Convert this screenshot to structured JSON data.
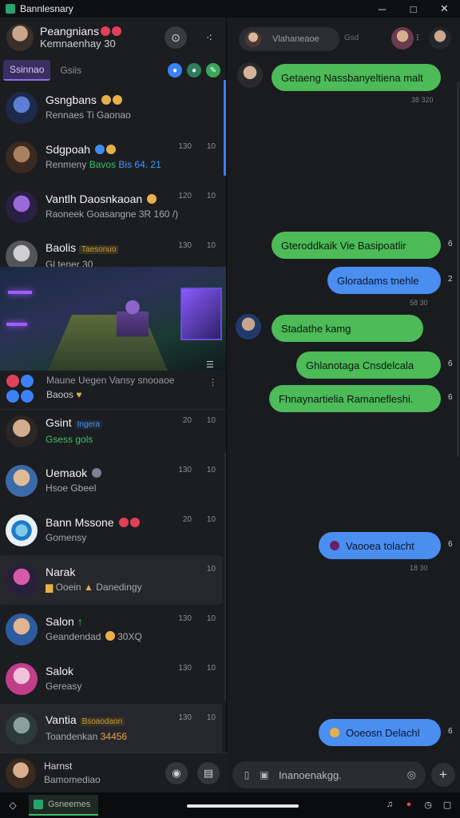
{
  "window": {
    "title": "Bannlesnary",
    "minimize": "─",
    "maximize": "□",
    "close": "✕"
  },
  "profile": {
    "name": "Peangnians",
    "status": "Kemnaenhay 30",
    "btn_search": "⊙",
    "btn_more": "⁖"
  },
  "tabs": [
    {
      "label": "Ssinnao",
      "active": true
    },
    {
      "label": "Gsiis",
      "active": false
    }
  ],
  "chats": [
    {
      "name": "Gsngbans",
      "preview": "Rennaes Ti Gaonao",
      "time": "",
      "badge": ""
    },
    {
      "name": "Sdgpoah",
      "preview": "Renmeny",
      "highlight": "Bavos",
      "highlight2": "Bis 64. 21",
      "time": "130",
      "badge": "10"
    },
    {
      "name": "Vantlh Daosnkaoan",
      "preview": "Raoneek Goasangne 3R 160 /)",
      "time": "120",
      "badge": "10"
    },
    {
      "name": "Baolis",
      "tag": "Taesonuo",
      "preview": "Gl tener 30",
      "time": "130",
      "badge": "10"
    },
    {
      "name": "Gsint",
      "tag": "Ingera",
      "preview": "Gsess gols",
      "time": "20",
      "badge": "10"
    },
    {
      "name": "Uemaok",
      "preview": "Hsoe Gbeel",
      "time": "130",
      "badge": "10"
    },
    {
      "name": "Bann Mssone",
      "preview": "Gomensy",
      "time": "20",
      "badge": "10"
    },
    {
      "name": "Narak",
      "preview": "Ooein",
      "highlight": "Danedingy",
      "time": "",
      "badge": "10"
    },
    {
      "name": "Salon",
      "preview": "Geandendad",
      "highlight": "30XQ",
      "time": "130",
      "badge": "10"
    },
    {
      "name": "Salok",
      "preview": "Gereasy",
      "time": "130",
      "badge": "10"
    },
    {
      "name": "Vantia",
      "tag": "Bsoaodaon",
      "preview": "Toandenkan",
      "highlight": "34456",
      "time": "130",
      "badge": "10"
    }
  ],
  "notice": {
    "line1": "Maune Uegen Vansy snooaoe",
    "line2": "Baoos"
  },
  "composer_left": {
    "name": "Harnst",
    "preview": "Bamomediao"
  },
  "right_header": {
    "search_text": "Vlahaneaoe",
    "label": "Gsd"
  },
  "messages": [
    {
      "text": "Getaeng Nassbanyeltiena malt",
      "time": "38 320",
      "color": "green"
    },
    {
      "text": "Gteroddkaik Vie Basipoatlir",
      "side": "6",
      "color": "green"
    },
    {
      "text": "Gloradams tnehle",
      "side": "2",
      "time": "58 30",
      "color": "blue"
    },
    {
      "text": "Stadathe kamg",
      "color": "green"
    },
    {
      "text": "Ghlanotaga Cnsdelcala",
      "side": "6",
      "color": "green"
    },
    {
      "text": "Fhnaynartielia Ramanefleshi.",
      "side": "6",
      "color": "green"
    },
    {
      "text": "Vaooea tolacht",
      "side": "6",
      "time": "18 30",
      "color": "blue"
    },
    {
      "text": "Ooeosn Delachl",
      "side": "6",
      "color": "blue"
    }
  ],
  "composer_right": {
    "placeholder": "Inanoenakgg.",
    "plus": "+"
  },
  "taskbar": {
    "app_label": "Gsneemes"
  },
  "colors": {
    "accent_green": "#4cbb58",
    "accent_blue": "#4a8ff0",
    "tab_accent": "#8f6cf0"
  }
}
